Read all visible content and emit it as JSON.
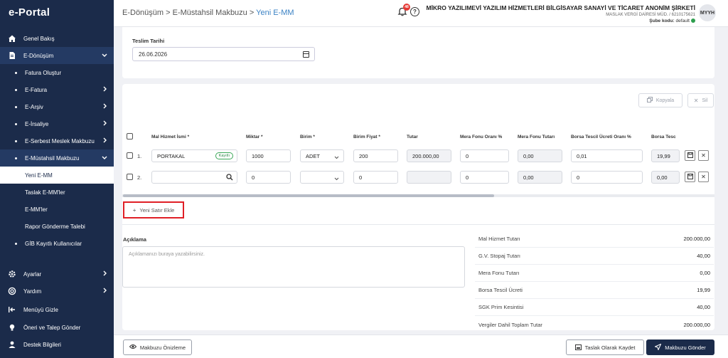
{
  "app": {
    "logo": "e-Portal"
  },
  "sidebar": {
    "items": [
      {
        "label": "Genel Bakış",
        "icon": "home-icon"
      },
      {
        "label": "E-Dönüşüm",
        "icon": "document-icon"
      },
      {
        "label": "Fatura Oluştur"
      },
      {
        "label": "E-Fatura"
      },
      {
        "label": "E-Arşiv"
      },
      {
        "label": "E-İrsaliye"
      },
      {
        "label": "E-Serbest Meslek Makbuzu"
      },
      {
        "label": "E-Müstahsil Makbuzu"
      },
      {
        "label": "Yeni E-MM"
      },
      {
        "label": "Taslak E-MM'ler"
      },
      {
        "label": "E-MM'ler"
      },
      {
        "label": "Rapor Gönderme Talebi"
      },
      {
        "label": "GİB Kayıtlı Kullanıcılar"
      },
      {
        "label": "Ayarlar",
        "icon": "gear-icon"
      },
      {
        "label": "Yardım",
        "icon": "lifebuoy-icon"
      },
      {
        "label": "Menüyü Gizle",
        "icon": "collapse-menu-icon"
      },
      {
        "label": "Öneri ve Talep Gönder",
        "icon": "lightbulb-icon"
      },
      {
        "label": "Destek Bilgileri",
        "icon": "support-icon"
      }
    ]
  },
  "header": {
    "breadcrumb": [
      "E-Dönüşüm",
      "E-Müstahsil Makbuzu",
      "Yeni E-MM"
    ],
    "separator": ">",
    "notification_count": "48",
    "company_name": "MİKRO YAZILIMEVİ YAZILIM HİZMETLERİ BİLGİSAYAR SANAYİ VE TİCARET ANONİM ŞİRKETİ",
    "tax_office": "MASLAK VERGİ DAİRESİ MÜD. / 6210175621",
    "branch_label": "Şube kodu:",
    "branch_value": "default",
    "avatar": "MYYH",
    "help_glyph": "?"
  },
  "form": {
    "delivery_date_label": "Teslim Tarihi",
    "delivery_date_value": "26.06.2026"
  },
  "toolbar": {
    "copy_label": "Kopyala",
    "delete_label": "Sil"
  },
  "table": {
    "columns": [
      "Mal Hizmet İsmi *",
      "Miktar *",
      "Birim *",
      "Birim Fiyat *",
      "Tutar",
      "Mera Fonu Oranı %",
      "Mera Fonu Tutarı",
      "Borsa Tescil Ücreti Oranı %",
      "Borsa Tesc"
    ],
    "rows": [
      {
        "num": "1.",
        "name": "PORTAKAL",
        "badge": "Kayıtlı",
        "qty": "1000",
        "unit": "ADET",
        "price": "200",
        "total": "200.000,00",
        "mera_rate": "0",
        "mera_amount": "0,00",
        "borsa_rate": "0,01",
        "borsa": "19,99"
      },
      {
        "num": "2.",
        "name": "",
        "badge": "",
        "qty": "0",
        "unit": "",
        "price": "0",
        "total": "",
        "mera_rate": "0",
        "mera_amount": "0,00",
        "borsa_rate": "0",
        "borsa": "0,00"
      }
    ],
    "add_row_label": "Yeni Satır Ekle",
    "add_glyph": "+",
    "remove_glyph": "✕"
  },
  "description": {
    "label": "Açıklama",
    "placeholder": "Açıklamanızı buraya yazabilirsiniz."
  },
  "summary": [
    {
      "label": "Mal Hizmet Tutarı",
      "value": "200.000,00"
    },
    {
      "label": "G.V. Stopaj Tutarı",
      "value": "40,00"
    },
    {
      "label": "Mera Fonu Tutarı",
      "value": "0,00"
    },
    {
      "label": "Borsa Tescil Ücreti",
      "value": "19,99"
    },
    {
      "label": "SGK Prim Kesintisi",
      "value": "40,00"
    },
    {
      "label": "Vergiler Dahil Toplam Tutar",
      "value": "200.000,00"
    }
  ],
  "footer": {
    "preview_label": "Makbuzu Önizleme",
    "save_draft_label": "Taslak Olarak Kaydet",
    "send_label": "Makbuzu Gönder"
  },
  "colors": {
    "sidebar": "#1b2b4a",
    "accent": "#3b82c4",
    "highlight": "#e01f26",
    "success": "#2e9e4f"
  }
}
